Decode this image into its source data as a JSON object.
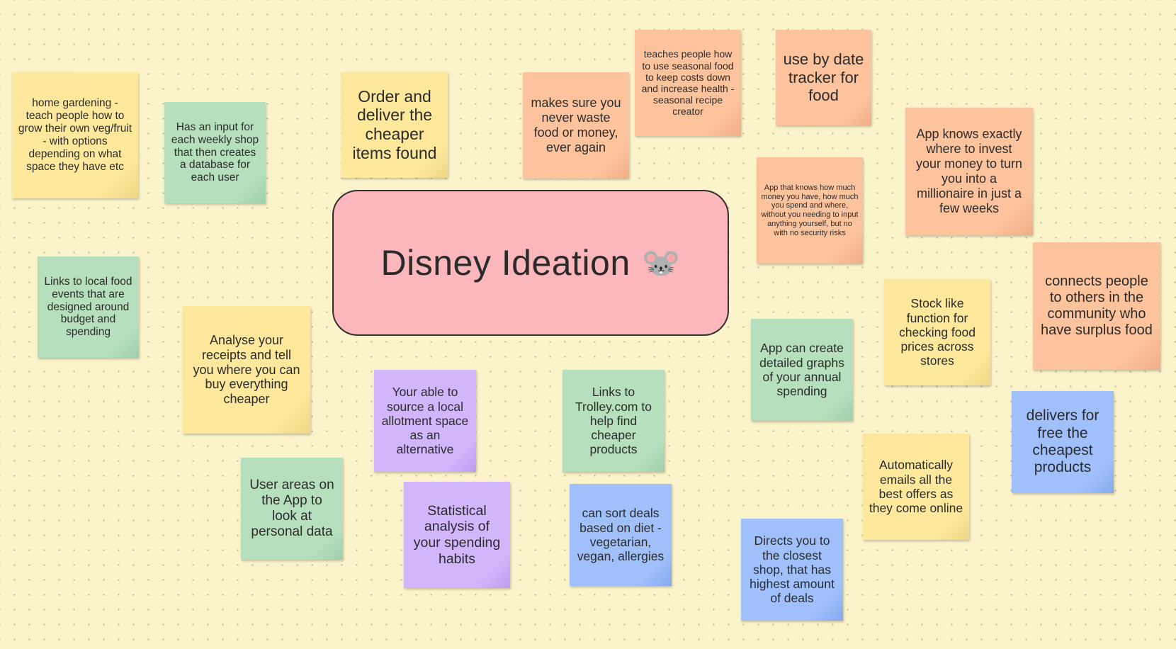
{
  "board": {
    "title": "Disney Ideation",
    "title_emoji": "🐭",
    "colors": {
      "background": "#fbf3c9",
      "center_card": "#fbb7bb",
      "yellow": "#fde79c",
      "green": "#b6e0bd",
      "orange": "#fdc39d",
      "purple": "#d2b6fb",
      "blue": "#9fc0fb"
    }
  },
  "notes": [
    {
      "color": "yellow",
      "text": "home gardening - teach people how to grow their own veg/fruit - with options depending on what space they have etc"
    },
    {
      "color": "green",
      "text": "Has an input for each weekly shop that then creates a database for each user"
    },
    {
      "color": "yellow",
      "text": "Order and deliver the cheaper items found"
    },
    {
      "color": "orange",
      "text": "makes sure you never waste food or money, ever again"
    },
    {
      "color": "orange",
      "text": "teaches people how to use seasonal food to keep costs down and increase health - seasonal recipe creator"
    },
    {
      "color": "orange",
      "text": "use by date tracker for food"
    },
    {
      "color": "orange",
      "text": "App knows exactly where to invest your money to turn you into a millionaire in just a few weeks"
    },
    {
      "color": "orange",
      "text": "App that knows how much money you have, how much you spend and where, without you needing to input anything yourself, but no with no security risks"
    },
    {
      "color": "orange",
      "text": "connects people to others in the community who have surplus food"
    },
    {
      "color": "green",
      "text": "Links to local food events that are designed around budget and spending"
    },
    {
      "color": "yellow",
      "text": "Analyse your receipts and tell you where you can buy everything cheaper"
    },
    {
      "color": "purple",
      "text": "Your able to source a local allotment space as an alternative"
    },
    {
      "color": "green",
      "text": "Links to Trolley.com to help find cheaper products"
    },
    {
      "color": "green",
      "text": "App can create detailed graphs of your annual spending"
    },
    {
      "color": "yellow",
      "text": "Stock like function for checking food prices across stores"
    },
    {
      "color": "blue",
      "text": "delivers for free the cheapest products"
    },
    {
      "color": "green",
      "text": "User areas on the App to look at personal data"
    },
    {
      "color": "purple",
      "text": "Statistical analysis of your spending habits"
    },
    {
      "color": "blue",
      "text": "can sort deals based on diet - vegetarian, vegan, allergies"
    },
    {
      "color": "yellow",
      "text": "Automatically emails all the best offers as they come online"
    },
    {
      "color": "blue",
      "text": "Directs you to the closest shop, that has highest amount of deals"
    }
  ]
}
